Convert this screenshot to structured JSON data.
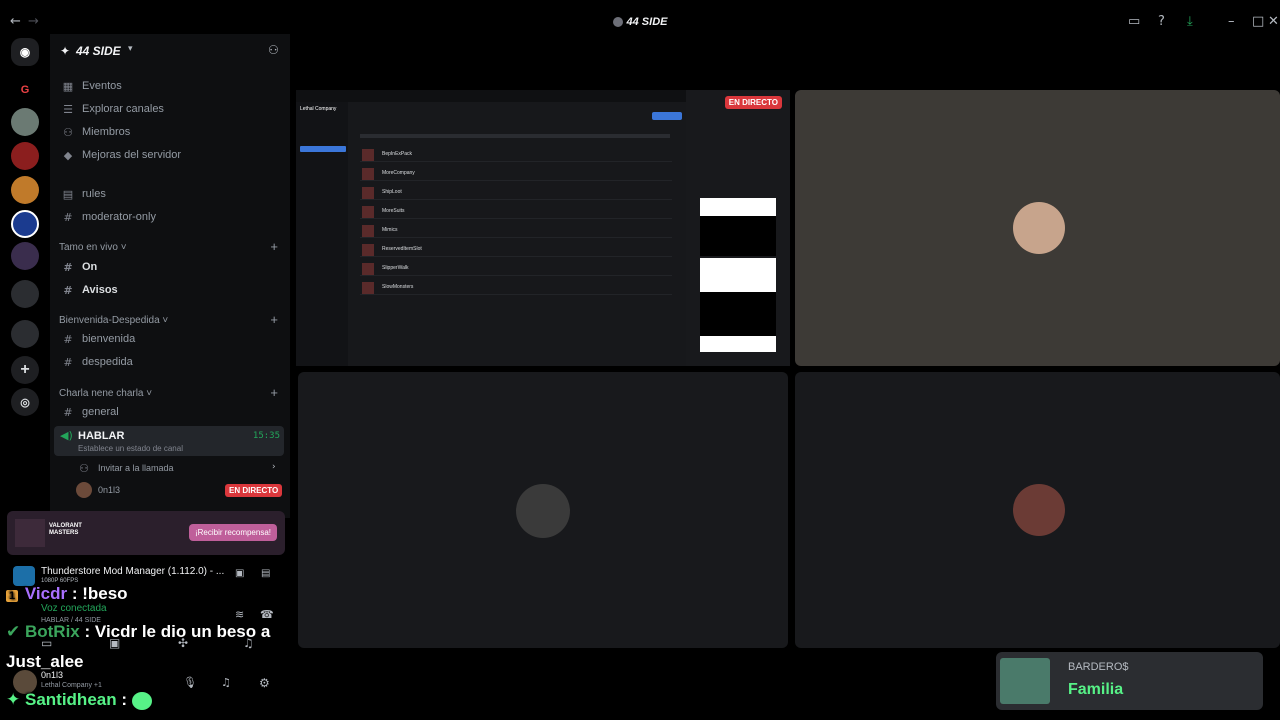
{
  "window": {
    "title": "44 SIDE"
  },
  "server": {
    "name": "44 SIDE"
  },
  "nav_items": [
    {
      "label": "Eventos",
      "icon": "calendar-icon"
    },
    {
      "label": "Explorar canales",
      "icon": "list-icon"
    },
    {
      "label": "Miembros",
      "icon": "members-icon"
    },
    {
      "label": "Mejoras del servidor",
      "icon": "boost-icon"
    }
  ],
  "top_channels": [
    {
      "label": "rules",
      "icon": "rules-icon"
    },
    {
      "label": "moderator-only",
      "icon": "hash-icon"
    }
  ],
  "categories": {
    "tamo": {
      "label": "Tamo en vivo",
      "channels": [
        "On",
        "Avisos"
      ]
    },
    "bienvenida": {
      "label": "Bienvenida-Despedida",
      "channels": [
        "bienvenida",
        "despedida"
      ]
    },
    "charla": {
      "label": "Charla nene charla",
      "channels": [
        "general"
      ]
    }
  },
  "voice": {
    "name": "HABLAR",
    "time": "15:35",
    "status_hint": "Establece un estado de canal",
    "invite_label": "Invitar a la llamada",
    "member": "0n1l3",
    "live_badge": "EN DIRECTO"
  },
  "promo": {
    "brand_line1": "VALORANT",
    "brand_line2": "MASTERS",
    "button": "¡Recibir recompensa!"
  },
  "stream_window": {
    "app_title": "Thunderstore Mod Manager (1.112.0) - ...",
    "quality": "1080P 60FPS",
    "connection_status": "Voz conectada",
    "channel_path": "HABLAR / 44 SIDE"
  },
  "user": {
    "name": "0n1l3",
    "activity": "Lethal Company +1"
  },
  "stream_badge": "EN DIRECTO",
  "stream_content": {
    "game": "Lethal Company",
    "mods_rows": [
      "BepInExPack",
      "MoreCompany",
      "ShipLoot",
      "MoreSuits",
      "Mimics",
      "ReservedItemSlot",
      "SlipperWalk",
      "SlowMonsters"
    ]
  },
  "chat": [
    {
      "badge": "1",
      "user": "Vicdr",
      "sep": ":",
      "text": "!beso",
      "user_color": "#a970ff"
    },
    {
      "user": "BotRix",
      "sep": ":",
      "text": "Vicdr le dio un beso a",
      "text2": "Just_alee",
      "user_color": "#3ba55c"
    },
    {
      "user": "Santidhean",
      "sep": ":",
      "text": "",
      "user_color": "#57f287"
    }
  ],
  "notification": {
    "title": "BARDERO$",
    "subtitle": "Familia"
  },
  "colors": {
    "accent": "#5865f2",
    "live": "#da373c",
    "chat_name_green": "#57f287"
  }
}
